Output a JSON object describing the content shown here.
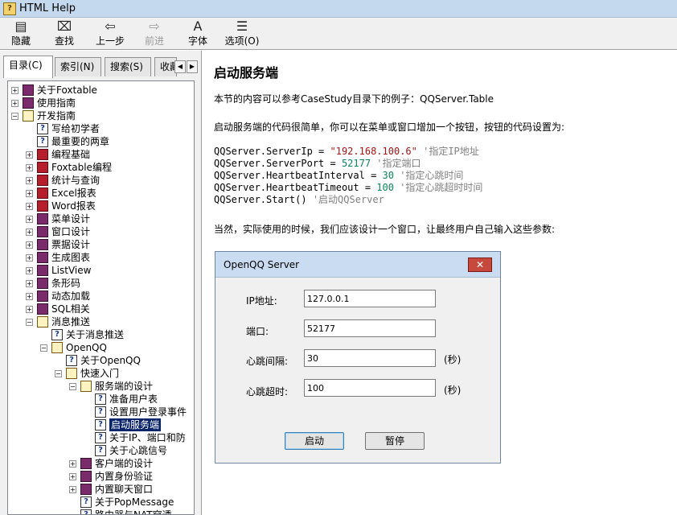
{
  "window": {
    "title": "HTML Help"
  },
  "toolbar": [
    {
      "icon": "hide-icon",
      "glyph": "▤",
      "label": "隐藏",
      "enabled": true
    },
    {
      "icon": "find-icon",
      "glyph": "⌧",
      "label": "查找",
      "enabled": true
    },
    {
      "icon": "back-icon",
      "glyph": "⇦",
      "label": "上一步",
      "enabled": true
    },
    {
      "icon": "forward-icon",
      "glyph": "⇨",
      "label": "前进",
      "enabled": false
    },
    {
      "icon": "font-icon",
      "glyph": "A",
      "label": "字体",
      "enabled": true
    },
    {
      "icon": "options-icon",
      "glyph": "☰",
      "label": "选项(O)",
      "enabled": true
    }
  ],
  "tabs": [
    {
      "label": "目录(C)",
      "active": true
    },
    {
      "label": "索引(N)",
      "active": false
    },
    {
      "label": "搜索(S)",
      "active": false
    },
    {
      "label": "收藏",
      "active": false
    }
  ],
  "tree": [
    {
      "level": 0,
      "exp": "+",
      "type": "book",
      "label": "关于Foxtable"
    },
    {
      "level": 0,
      "exp": "+",
      "type": "book",
      "label": "使用指南"
    },
    {
      "level": 0,
      "exp": "-",
      "type": "open",
      "label": "开发指南"
    },
    {
      "level": 1,
      "exp": "",
      "type": "page",
      "label": "写给初学者"
    },
    {
      "level": 1,
      "exp": "",
      "type": "page",
      "label": "最重要的两章"
    },
    {
      "level": 1,
      "exp": "+",
      "type": "red",
      "label": "编程基础"
    },
    {
      "level": 1,
      "exp": "+",
      "type": "red",
      "label": "Foxtable编程"
    },
    {
      "level": 1,
      "exp": "+",
      "type": "red",
      "label": "统计与查询"
    },
    {
      "level": 1,
      "exp": "+",
      "type": "red",
      "label": "Excel报表"
    },
    {
      "level": 1,
      "exp": "+",
      "type": "red",
      "label": "Word报表"
    },
    {
      "level": 1,
      "exp": "+",
      "type": "book",
      "label": "菜单设计"
    },
    {
      "level": 1,
      "exp": "+",
      "type": "book",
      "label": "窗口设计"
    },
    {
      "level": 1,
      "exp": "+",
      "type": "book",
      "label": "票据设计"
    },
    {
      "level": 1,
      "exp": "+",
      "type": "book",
      "label": "生成图表"
    },
    {
      "level": 1,
      "exp": "+",
      "type": "book",
      "label": "ListView"
    },
    {
      "level": 1,
      "exp": "+",
      "type": "book",
      "label": "条形码"
    },
    {
      "level": 1,
      "exp": "+",
      "type": "book",
      "label": "动态加载"
    },
    {
      "level": 1,
      "exp": "+",
      "type": "book",
      "label": "SQL相关"
    },
    {
      "level": 1,
      "exp": "-",
      "type": "open",
      "label": "消息推送"
    },
    {
      "level": 2,
      "exp": "",
      "type": "page",
      "label": "关于消息推送"
    },
    {
      "level": 2,
      "exp": "-",
      "type": "open",
      "label": "OpenQQ"
    },
    {
      "level": 3,
      "exp": "",
      "type": "page",
      "label": "关于OpenQQ"
    },
    {
      "level": 3,
      "exp": "-",
      "type": "open",
      "label": "快速入门"
    },
    {
      "level": 4,
      "exp": "-",
      "type": "open",
      "label": "服务端的设计"
    },
    {
      "level": 5,
      "exp": "",
      "type": "page",
      "label": "准备用户表"
    },
    {
      "level": 5,
      "exp": "",
      "type": "page",
      "label": "设置用户登录事件"
    },
    {
      "level": 5,
      "exp": "",
      "type": "page",
      "label": "启动服务端",
      "selected": true
    },
    {
      "level": 5,
      "exp": "",
      "type": "page",
      "label": "关于IP、端口和防"
    },
    {
      "level": 5,
      "exp": "",
      "type": "page",
      "label": "关于心跳信号"
    },
    {
      "level": 4,
      "exp": "+",
      "type": "book",
      "label": "客户端的设计"
    },
    {
      "level": 4,
      "exp": "+",
      "type": "book",
      "label": "内置身份验证"
    },
    {
      "level": 4,
      "exp": "+",
      "type": "book",
      "label": "内置聊天窗口"
    },
    {
      "level": 4,
      "exp": "",
      "type": "page",
      "label": "关于PopMessage"
    },
    {
      "level": 4,
      "exp": "",
      "type": "page",
      "label": "路由器与NAT穿透"
    }
  ],
  "content": {
    "heading": "启动服务端",
    "p1": "本节的内容可以参考CaseStudy目录下的例子：QQServer.Table",
    "p2": "启动服务端的代码很简单，你可以在菜单或窗口增加一个按钮，按钮的代码设置为:",
    "code": [
      {
        "prop": "QQServer.ServerIp = ",
        "val": "\"192.168.100.6\"",
        "kind": "str",
        "comment": " '指定IP地址"
      },
      {
        "prop": "QQServer.ServerPort = ",
        "val": "52177",
        "kind": "num",
        "comment": " '指定端口"
      },
      {
        "prop": "QQServer.HeartbeatInterval = ",
        "val": "30",
        "kind": "num",
        "comment": " '指定心跳时间"
      },
      {
        "prop": "QQServer.HeartbeatTimeout = ",
        "val": "100",
        "kind": "num",
        "comment": " '指定心跳超时时间"
      },
      {
        "prop": "QQServer.Start()",
        "val": "",
        "kind": "",
        "comment": " '启动QQServer"
      }
    ],
    "p3": "当然，实际使用的时候，我们应该设计一个窗口，让最终用户自己输入这些参数:"
  },
  "dialog": {
    "title": "OpenQQ Server",
    "close_glyph": "✕",
    "fields": [
      {
        "label": "IP地址:",
        "value": "127.0.0.1",
        "unit": ""
      },
      {
        "label": "端口:",
        "value": "52177",
        "unit": ""
      },
      {
        "label": "心跳间隔:",
        "value": "30",
        "unit": "(秒)"
      },
      {
        "label": "心跳超时:",
        "value": "100",
        "unit": "(秒)"
      }
    ],
    "start_label": "启动",
    "pause_label": "暂停"
  }
}
